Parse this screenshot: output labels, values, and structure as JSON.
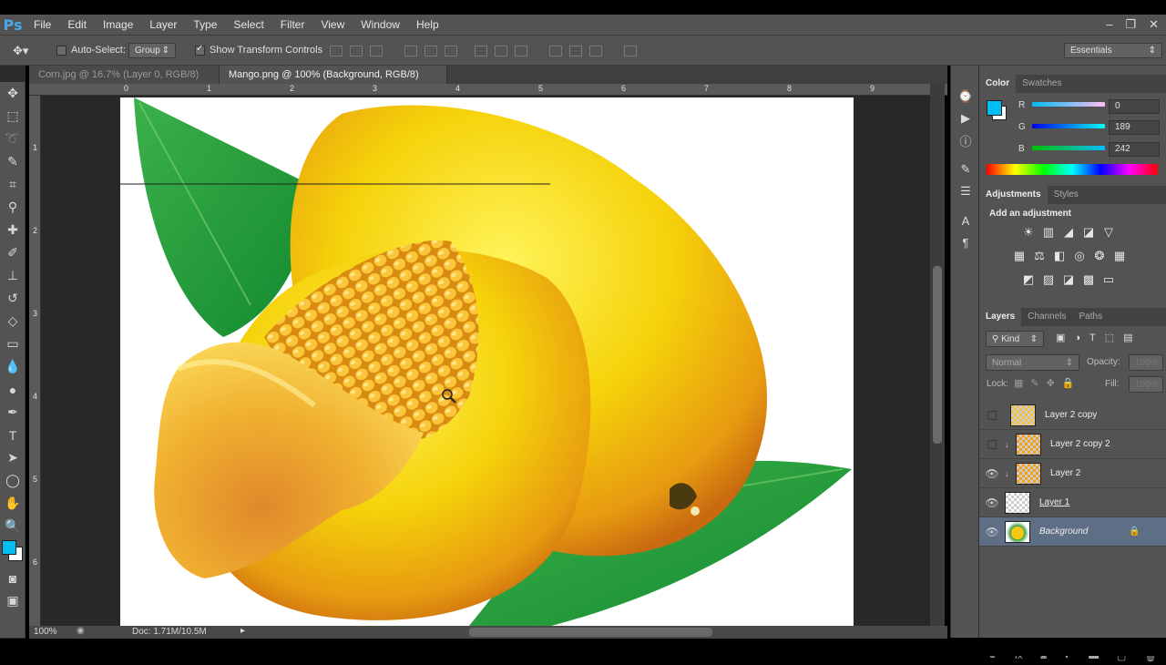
{
  "app": {
    "logo": "Ps"
  },
  "menu": [
    "File",
    "Edit",
    "Image",
    "Layer",
    "Type",
    "Select",
    "Filter",
    "View",
    "Window",
    "Help"
  ],
  "window_controls": {
    "minimize": "–",
    "restore": "❐",
    "close": "✕"
  },
  "options": {
    "auto_select_label": "Auto-Select:",
    "auto_select_checked": false,
    "auto_select_value": "Group",
    "transform_label": "Show Transform Controls",
    "transform_checked": true,
    "workspace": "Essentials"
  },
  "tabs": [
    {
      "label": "Corn.jpg @ 16.7% (Layer 0, RGB/8) *",
      "active": false
    },
    {
      "label": "Mango.png @ 100% (Background, RGB/8) *",
      "active": true
    }
  ],
  "ruler_top": [
    "0",
    "1",
    "2",
    "3",
    "4",
    "5",
    "6",
    "7",
    "8",
    "9"
  ],
  "ruler_left": [
    "1",
    "2",
    "3",
    "4",
    "5",
    "6"
  ],
  "status": {
    "zoom": "100%",
    "doc": "Doc: 1.71M/10.5M"
  },
  "colors": {
    "foreground": "#00bdf2",
    "background": "#ffffff",
    "accent": "#5e6e85"
  },
  "color_panel": {
    "tabs": [
      "Color",
      "Swatches"
    ],
    "channels": [
      {
        "label": "R",
        "value": "0"
      },
      {
        "label": "G",
        "value": "189"
      },
      {
        "label": "B",
        "value": "242"
      }
    ]
  },
  "adjustments_panel": {
    "tabs": [
      "Adjustments",
      "Styles"
    ],
    "heading": "Add an adjustment",
    "row1": [
      "☀",
      "▥",
      "◢",
      "◪",
      "▽"
    ],
    "row2": [
      "▦",
      "⚖",
      "◧",
      "◎",
      "❂",
      "▦"
    ],
    "row3": [
      "◩",
      "▨",
      "◪",
      "▩",
      "▭"
    ]
  },
  "layers_panel": {
    "tabs": [
      "Layers",
      "Channels",
      "Paths"
    ],
    "kind": "Kind",
    "blend_mode": "Normal",
    "opacity_label": "Opacity:",
    "opacity_value": "100%",
    "lock_label": "Lock:",
    "fill_label": "Fill:",
    "fill_value": "100%",
    "layers": [
      {
        "name": "Layer 2 copy",
        "visible": false,
        "clipped": false,
        "selected": false
      },
      {
        "name": "Layer 2 copy 2",
        "visible": false,
        "clipped": true,
        "selected": false
      },
      {
        "name": "Layer 2",
        "visible": true,
        "clipped": true,
        "selected": false
      },
      {
        "name": "Layer 1",
        "visible": true,
        "clipped": false,
        "selected": false
      },
      {
        "name": "Background",
        "visible": true,
        "clipped": false,
        "selected": true,
        "locked": true
      }
    ]
  },
  "tools": [
    "move-tool",
    "marquee-tool",
    "lasso-tool",
    "quick-select-tool",
    "crop-tool",
    "eyedropper-tool",
    "healing-tool",
    "brush-tool",
    "stamp-tool",
    "history-brush-tool",
    "eraser-tool",
    "gradient-tool",
    "blur-tool",
    "dodge-tool",
    "pen-tool",
    "type-tool",
    "path-select-tool",
    "shape-tool",
    "hand-tool",
    "zoom-tool"
  ]
}
